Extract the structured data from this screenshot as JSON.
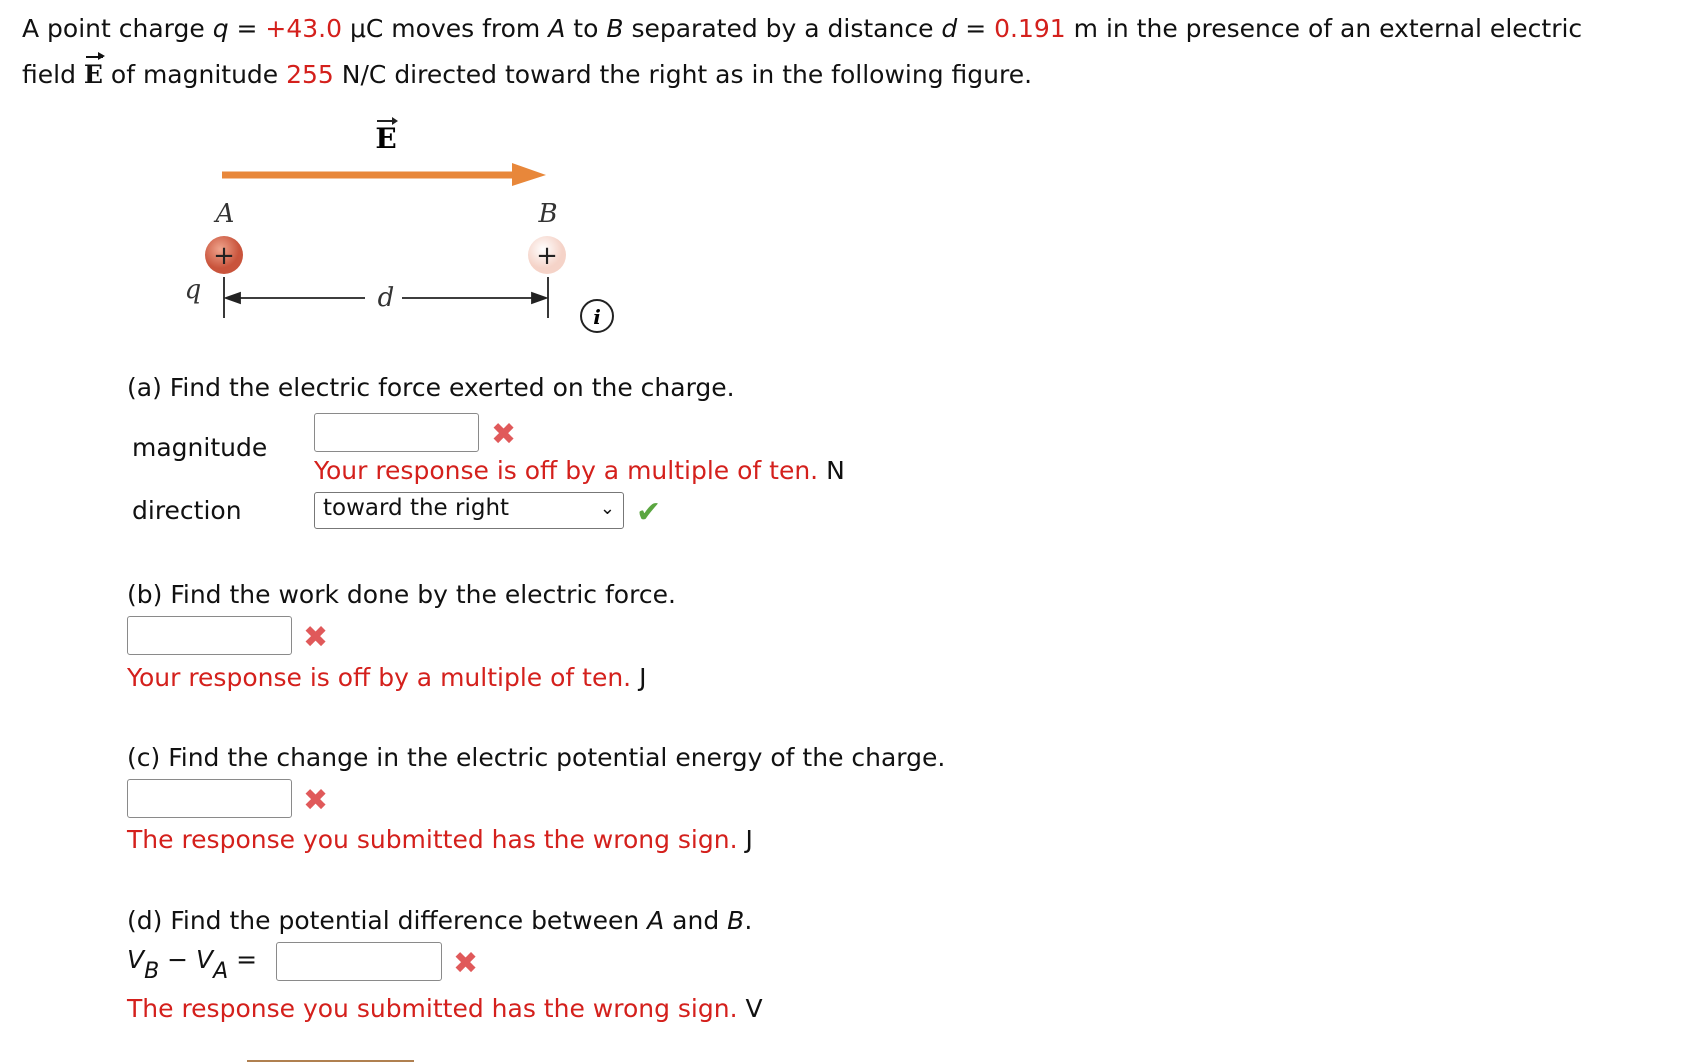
{
  "problem": {
    "intro_1": "A point charge ",
    "q_symbol": "q",
    "eq": " = ",
    "q_value": "+43.0",
    "q_unit": " μC moves from ",
    "A": "A",
    "to": " to ",
    "B": "B",
    "sep": " separated by a distance ",
    "d_symbol": "d",
    "d_value": "0.191",
    "d_rest": " m in the presence of an external electric",
    "line2_start": "field ",
    "E_symbol": "E",
    "line2_mid": " of magnitude ",
    "E_value": "255",
    "line2_end": " N/C directed toward the right as in the following figure."
  },
  "figure": {
    "E_label": "E",
    "A_label": "A",
    "B_label": "B",
    "q_label": "q",
    "d_label": "d",
    "plus": "+",
    "info": "i",
    "arrow_color": "#e8873a",
    "charge_color": "#d9705a"
  },
  "part_a": {
    "question": "(a) Find the electric force exerted on the charge.",
    "magnitude_label": "magnitude",
    "magnitude_value": "",
    "magnitude_feedback": "Your response is off by a multiple of ten.",
    "magnitude_unit": " N",
    "direction_label": "direction",
    "direction_value": "toward the right"
  },
  "part_b": {
    "question": "(b) Find the work done by the electric force.",
    "value": "",
    "feedback": "Your response is off by a multiple of ten.",
    "unit": " J"
  },
  "part_c": {
    "question": "(c) Find the change in the electric potential energy of the charge.",
    "value": "",
    "feedback": "The response you submitted has the wrong sign.",
    "unit": " J"
  },
  "part_d": {
    "question_start": "(d) Find the potential difference between ",
    "A": "A",
    "and": " and ",
    "B": "B",
    "period": ".",
    "V": "V",
    "sub_B": "B",
    "minus": " − ",
    "sub_A": "A",
    "equals": " =",
    "value": "",
    "feedback": "The response you submitted has the wrong sign.",
    "unit": " V"
  },
  "marks": {
    "wrong": "✖",
    "correct": "✔",
    "chevron": "⌄"
  }
}
